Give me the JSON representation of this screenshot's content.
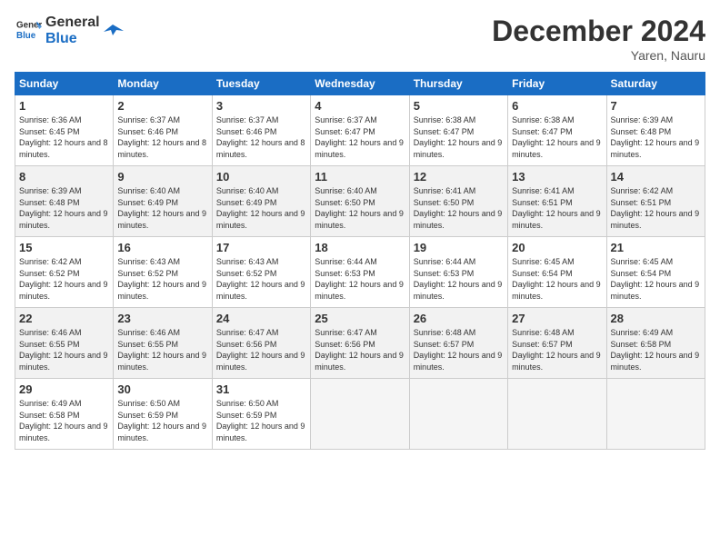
{
  "logo": {
    "line1": "General",
    "line2": "Blue"
  },
  "title": "December 2024",
  "location": "Yaren, Nauru",
  "days_of_week": [
    "Sunday",
    "Monday",
    "Tuesday",
    "Wednesday",
    "Thursday",
    "Friday",
    "Saturday"
  ],
  "weeks": [
    [
      {
        "day": "1",
        "sunrise": "6:36 AM",
        "sunset": "6:45 PM",
        "daylight": "12 hours and 8 minutes."
      },
      {
        "day": "2",
        "sunrise": "6:37 AM",
        "sunset": "6:46 PM",
        "daylight": "12 hours and 8 minutes."
      },
      {
        "day": "3",
        "sunrise": "6:37 AM",
        "sunset": "6:46 PM",
        "daylight": "12 hours and 8 minutes."
      },
      {
        "day": "4",
        "sunrise": "6:37 AM",
        "sunset": "6:47 PM",
        "daylight": "12 hours and 9 minutes."
      },
      {
        "day": "5",
        "sunrise": "6:38 AM",
        "sunset": "6:47 PM",
        "daylight": "12 hours and 9 minutes."
      },
      {
        "day": "6",
        "sunrise": "6:38 AM",
        "sunset": "6:47 PM",
        "daylight": "12 hours and 9 minutes."
      },
      {
        "day": "7",
        "sunrise": "6:39 AM",
        "sunset": "6:48 PM",
        "daylight": "12 hours and 9 minutes."
      }
    ],
    [
      {
        "day": "8",
        "sunrise": "6:39 AM",
        "sunset": "6:48 PM",
        "daylight": "12 hours and 9 minutes."
      },
      {
        "day": "9",
        "sunrise": "6:40 AM",
        "sunset": "6:49 PM",
        "daylight": "12 hours and 9 minutes."
      },
      {
        "day": "10",
        "sunrise": "6:40 AM",
        "sunset": "6:49 PM",
        "daylight": "12 hours and 9 minutes."
      },
      {
        "day": "11",
        "sunrise": "6:40 AM",
        "sunset": "6:50 PM",
        "daylight": "12 hours and 9 minutes."
      },
      {
        "day": "12",
        "sunrise": "6:41 AM",
        "sunset": "6:50 PM",
        "daylight": "12 hours and 9 minutes."
      },
      {
        "day": "13",
        "sunrise": "6:41 AM",
        "sunset": "6:51 PM",
        "daylight": "12 hours and 9 minutes."
      },
      {
        "day": "14",
        "sunrise": "6:42 AM",
        "sunset": "6:51 PM",
        "daylight": "12 hours and 9 minutes."
      }
    ],
    [
      {
        "day": "15",
        "sunrise": "6:42 AM",
        "sunset": "6:52 PM",
        "daylight": "12 hours and 9 minutes."
      },
      {
        "day": "16",
        "sunrise": "6:43 AM",
        "sunset": "6:52 PM",
        "daylight": "12 hours and 9 minutes."
      },
      {
        "day": "17",
        "sunrise": "6:43 AM",
        "sunset": "6:52 PM",
        "daylight": "12 hours and 9 minutes."
      },
      {
        "day": "18",
        "sunrise": "6:44 AM",
        "sunset": "6:53 PM",
        "daylight": "12 hours and 9 minutes."
      },
      {
        "day": "19",
        "sunrise": "6:44 AM",
        "sunset": "6:53 PM",
        "daylight": "12 hours and 9 minutes."
      },
      {
        "day": "20",
        "sunrise": "6:45 AM",
        "sunset": "6:54 PM",
        "daylight": "12 hours and 9 minutes."
      },
      {
        "day": "21",
        "sunrise": "6:45 AM",
        "sunset": "6:54 PM",
        "daylight": "12 hours and 9 minutes."
      }
    ],
    [
      {
        "day": "22",
        "sunrise": "6:46 AM",
        "sunset": "6:55 PM",
        "daylight": "12 hours and 9 minutes."
      },
      {
        "day": "23",
        "sunrise": "6:46 AM",
        "sunset": "6:55 PM",
        "daylight": "12 hours and 9 minutes."
      },
      {
        "day": "24",
        "sunrise": "6:47 AM",
        "sunset": "6:56 PM",
        "daylight": "12 hours and 9 minutes."
      },
      {
        "day": "25",
        "sunrise": "6:47 AM",
        "sunset": "6:56 PM",
        "daylight": "12 hours and 9 minutes."
      },
      {
        "day": "26",
        "sunrise": "6:48 AM",
        "sunset": "6:57 PM",
        "daylight": "12 hours and 9 minutes."
      },
      {
        "day": "27",
        "sunrise": "6:48 AM",
        "sunset": "6:57 PM",
        "daylight": "12 hours and 9 minutes."
      },
      {
        "day": "28",
        "sunrise": "6:49 AM",
        "sunset": "6:58 PM",
        "daylight": "12 hours and 9 minutes."
      }
    ],
    [
      {
        "day": "29",
        "sunrise": "6:49 AM",
        "sunset": "6:58 PM",
        "daylight": "12 hours and 9 minutes."
      },
      {
        "day": "30",
        "sunrise": "6:50 AM",
        "sunset": "6:59 PM",
        "daylight": "12 hours and 9 minutes."
      },
      {
        "day": "31",
        "sunrise": "6:50 AM",
        "sunset": "6:59 PM",
        "daylight": "12 hours and 9 minutes."
      },
      null,
      null,
      null,
      null
    ]
  ]
}
